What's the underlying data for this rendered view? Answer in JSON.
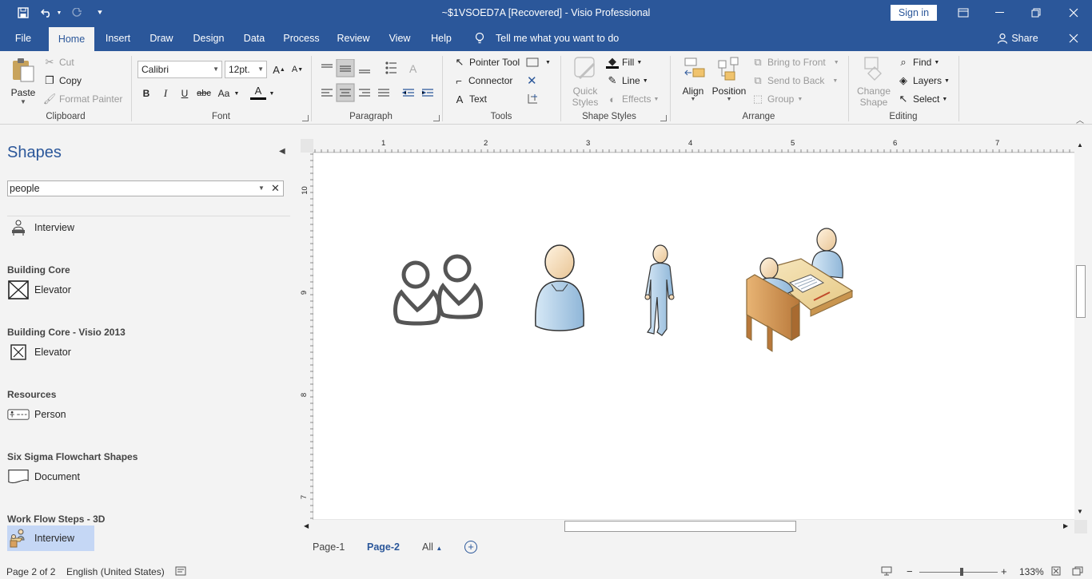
{
  "titlebar": {
    "title": "~$1VSOED7A  [Recovered]  -  Visio Professional",
    "sign_in": "Sign in"
  },
  "tabs": [
    "File",
    "Home",
    "Insert",
    "Draw",
    "Design",
    "Data",
    "Process",
    "Review",
    "View",
    "Help"
  ],
  "tell_me": "Tell me what you want to do",
  "share": "Share",
  "clipboard": {
    "paste": "Paste",
    "cut": "Cut",
    "copy": "Copy",
    "format_painter": "Format Painter",
    "label": "Clipboard"
  },
  "font": {
    "name": "Calibri",
    "size": "12pt.",
    "label": "Font",
    "bold": "B",
    "italic": "I",
    "underline": "U",
    "strike": "abc",
    "case": "Aa",
    "color_a": "A"
  },
  "paragraph": {
    "label": "Paragraph"
  },
  "tools": {
    "pointer": "Pointer Tool",
    "connector": "Connector",
    "text": "Text",
    "label": "Tools"
  },
  "shape_styles": {
    "quick_styles_1": "Quick",
    "quick_styles_2": "Styles",
    "fill": "Fill",
    "line": "Line",
    "effects": "Effects",
    "label": "Shape Styles"
  },
  "arrange": {
    "align": "Align",
    "position": "Position",
    "bring_front": "Bring to Front",
    "send_back": "Send to Back",
    "group": "Group",
    "label": "Arrange"
  },
  "editing": {
    "change_shape_1": "Change",
    "change_shape_2": "Shape",
    "find": "Find",
    "layers": "Layers",
    "select": "Select",
    "label": "Editing"
  },
  "shapes_panel": {
    "title": "Shapes",
    "search_value": "people",
    "stencils": [
      {
        "heading": "",
        "item": "Interview"
      },
      {
        "heading": "Building Core",
        "item": "Elevator"
      },
      {
        "heading": "Building Core - Visio 2013",
        "item": "Elevator"
      },
      {
        "heading": "Resources",
        "item": "Person"
      },
      {
        "heading": "Six Sigma Flowchart Shapes",
        "item": "Document"
      },
      {
        "heading": "Work Flow Steps - 3D",
        "item": "Interview"
      }
    ]
  },
  "ruler": {
    "h_labels": [
      "1",
      "2",
      "3",
      "4",
      "5",
      "6",
      "7"
    ],
    "v_labels": [
      "10",
      "9",
      "8",
      "7"
    ]
  },
  "page_tabs": {
    "page1": "Page-1",
    "page2": "Page-2",
    "all": "All"
  },
  "status": {
    "page": "Page 2 of 2",
    "language": "English (United States)",
    "zoom": "133%"
  },
  "colors": {
    "accent": "#2b579a",
    "figure_blue": "#a9cbe6",
    "figure_skin": "#f3d9b1",
    "desk": "#d9a15f"
  }
}
